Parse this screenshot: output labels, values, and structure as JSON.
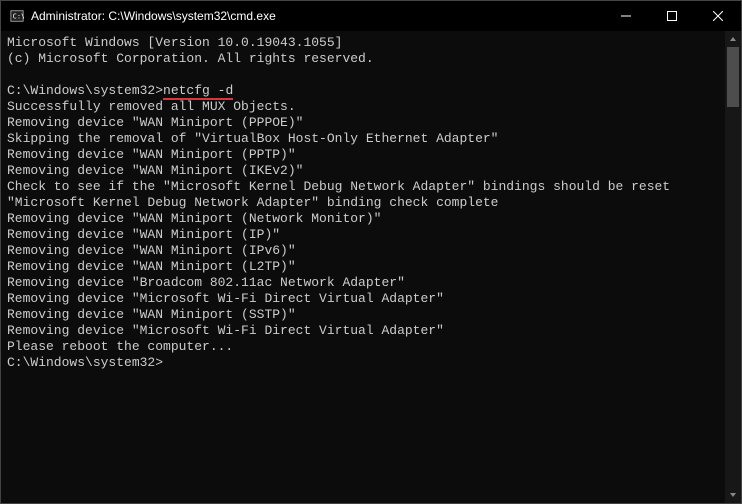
{
  "titlebar": {
    "title": "Administrator: C:\\Windows\\system32\\cmd.exe"
  },
  "terminal": {
    "lines": [
      "Microsoft Windows [Version 10.0.19043.1055]",
      "(c) Microsoft Corporation. All rights reserved.",
      "",
      {
        "prompt": "C:\\Windows\\system32>",
        "command": "netcfg -d",
        "highlight": true
      },
      "Successfully removed all MUX Objects.",
      "Removing device \"WAN Miniport (PPPOE)\"",
      "Skipping the removal of \"VirtualBox Host-Only Ethernet Adapter\"",
      "Removing device \"WAN Miniport (PPTP)\"",
      "Removing device \"WAN Miniport (IKEv2)\"",
      "Check to see if the \"Microsoft Kernel Debug Network Adapter\" bindings should be reset",
      "\"Microsoft Kernel Debug Network Adapter\" binding check complete",
      "Removing device \"WAN Miniport (Network Monitor)\"",
      "Removing device \"WAN Miniport (IP)\"",
      "Removing device \"WAN Miniport (IPv6)\"",
      "Removing device \"WAN Miniport (L2TP)\"",
      "Removing device \"Broadcom 802.11ac Network Adapter\"",
      "Removing device \"Microsoft Wi-Fi Direct Virtual Adapter\"",
      "Removing device \"WAN Miniport (SSTP)\"",
      "Removing device \"Microsoft Wi-Fi Direct Virtual Adapter\"",
      "Please reboot the computer...",
      {
        "prompt": "C:\\Windows\\system32>",
        "command": "",
        "highlight": false
      }
    ]
  }
}
